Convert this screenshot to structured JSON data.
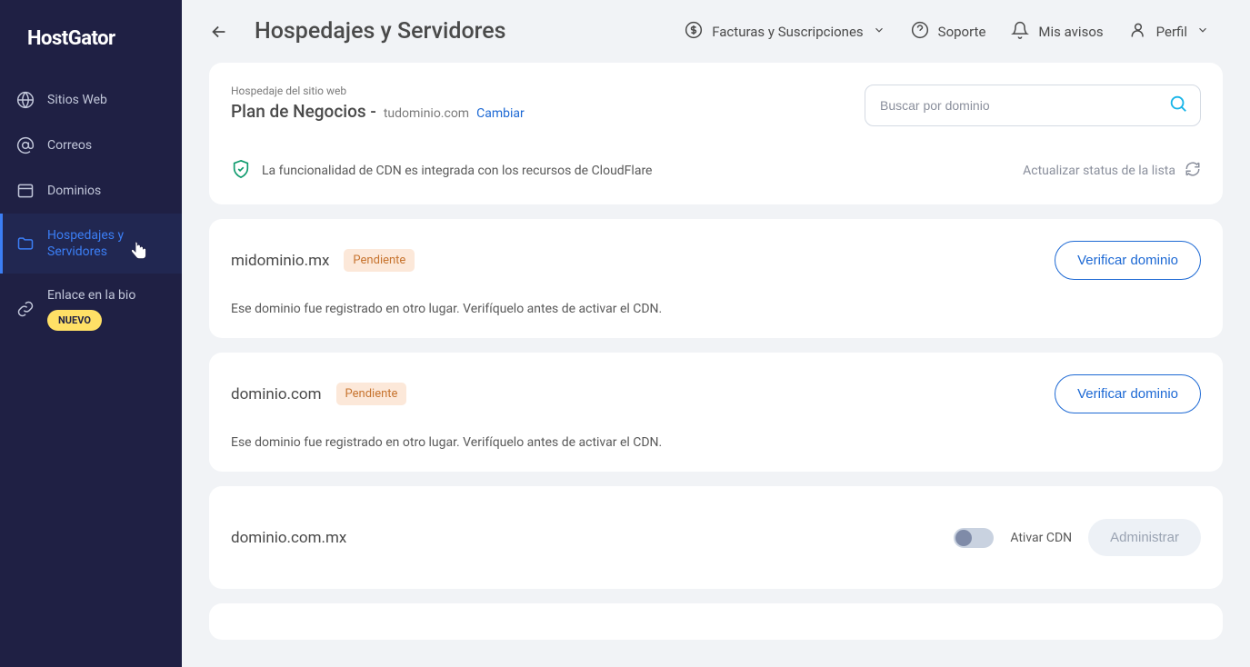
{
  "brand": "HostGator",
  "sidebar": {
    "items": [
      {
        "label": "Sitios Web"
      },
      {
        "label": "Correos"
      },
      {
        "label": "Dominios"
      },
      {
        "label": "Hospedajes y Servidores"
      },
      {
        "label": "Enlace en la bio",
        "badge": "NUEVO"
      }
    ]
  },
  "header": {
    "title": "Hospedajes y Servidores",
    "actions": {
      "facturas": "Facturas y Suscripciones",
      "soporte": "Soporte",
      "avisos": "Mis avisos",
      "perfil": "Perfil"
    }
  },
  "hosting_header": {
    "breadcrumb": "Hospedaje del sitio web",
    "plan": "Plan de Negocios -",
    "domain": "tudominio.com",
    "change": "Cambiar",
    "search_placeholder": "Buscar por dominio",
    "cdn_info": "La funcionalidad de CDN es integrada con los recursos de CloudFlare",
    "refresh": "Actualizar status de la lista"
  },
  "domains": [
    {
      "name": "midominio.mx",
      "status": "Pendiente",
      "desc": "Ese dominio fue registrado en otro lugar. Verifíquelo antes de activar el CDN.",
      "action": "Verificar dominio"
    },
    {
      "name": "dominio.com",
      "status": "Pendiente",
      "desc": "Ese dominio fue registrado en otro lugar. Verifíquelo antes de activar el CDN.",
      "action": "Verificar dominio"
    },
    {
      "name": "dominio.com.mx",
      "toggle_label": "Ativar CDN",
      "manage": "Administrar"
    }
  ]
}
